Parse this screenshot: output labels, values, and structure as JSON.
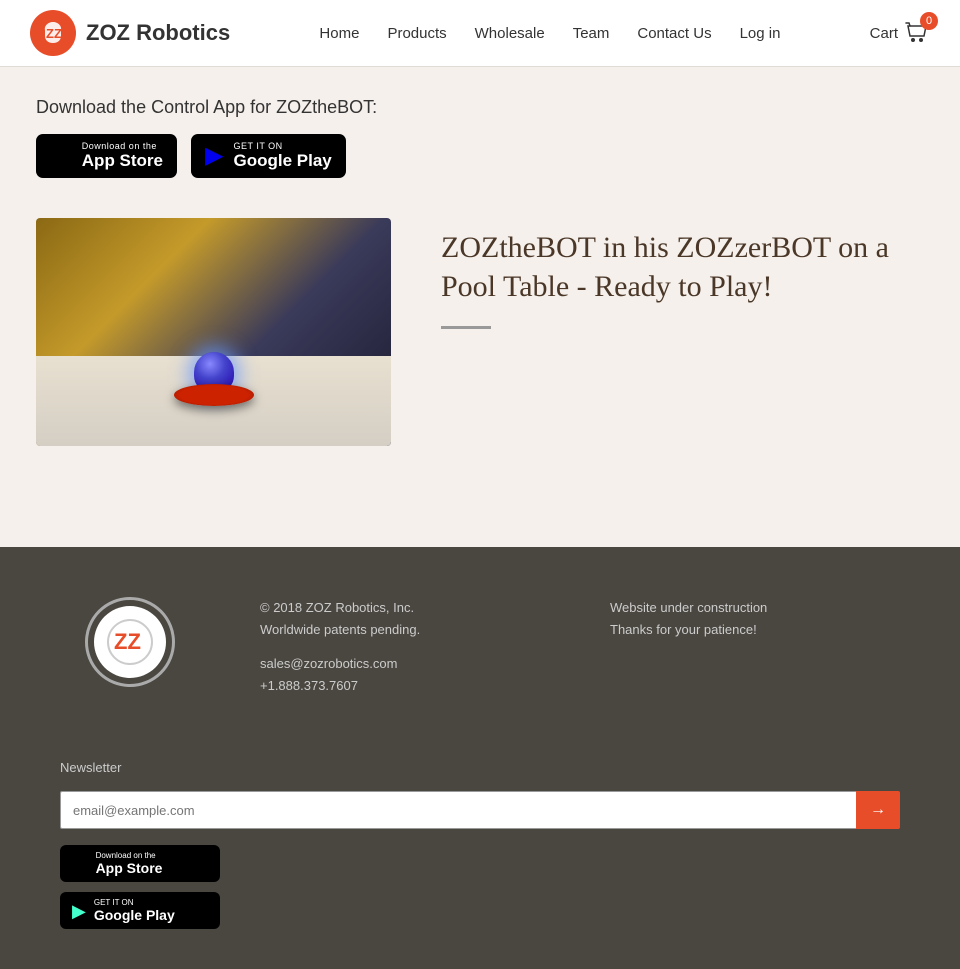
{
  "header": {
    "logo_text": "ZOZ Robotics",
    "nav_items": [
      {
        "label": "Home",
        "id": "home"
      },
      {
        "label": "Products",
        "id": "products"
      },
      {
        "label": "Wholesale",
        "id": "wholesale"
      },
      {
        "label": "Team",
        "id": "team"
      },
      {
        "label": "Contact Us",
        "id": "contact"
      },
      {
        "label": "Log in",
        "id": "login"
      }
    ],
    "cart_label": "Cart",
    "cart_count": "0"
  },
  "main": {
    "download_label": "Download the Control App for ZOZtheBOT:",
    "app_store": {
      "sub": "Download on the",
      "name": "App Store"
    },
    "google_play": {
      "sub": "GET IT ON",
      "name": "Google Play"
    },
    "hero_title": "ZOZtheBOT in his ZOZzerBOT on a Pool Table - Ready to Play!"
  },
  "footer": {
    "copyright": "© 2018 ZOZ Robotics, Inc.",
    "patents": "Worldwide patents pending.",
    "email": "sales@zozrobotics.com",
    "phone": "+1.888.373.7607",
    "website_status": "Website under construction",
    "thanks": "Thanks for your patience!",
    "newsletter_title": "Newsletter",
    "email_placeholder": "email@example.com",
    "app_store": {
      "sub": "Download on the",
      "name": "App Store"
    },
    "google_play": {
      "sub": "GET IT ON",
      "name": "Google Play"
    },
    "submit_arrow": "→"
  }
}
